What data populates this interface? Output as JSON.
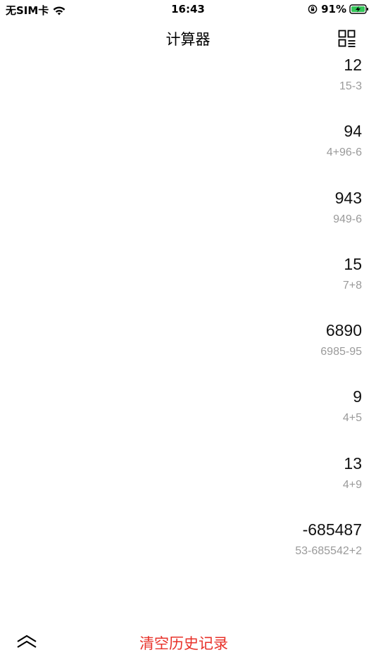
{
  "status_bar": {
    "carrier": "无SIM卡",
    "time": "16:43",
    "battery": "91%"
  },
  "nav": {
    "title": "计算器"
  },
  "history": [
    {
      "result": "12",
      "expression": "15-3"
    },
    {
      "result": "94",
      "expression": "4+96-6"
    },
    {
      "result": "943",
      "expression": "949-6"
    },
    {
      "result": "15",
      "expression": "7+8"
    },
    {
      "result": "6890",
      "expression": "6985-95"
    },
    {
      "result": "9",
      "expression": "4+5"
    },
    {
      "result": "13",
      "expression": "4+9"
    },
    {
      "result": "-685487",
      "expression": "53-685542+2"
    }
  ],
  "bottom": {
    "clear_label": "清空历史记录"
  },
  "colors": {
    "accent": "#e8322a",
    "expression": "#9a9a9a",
    "battery": "#34c759"
  },
  "icons": {
    "wifi": "wifi-icon",
    "orientation_lock": "orientation-lock-icon",
    "battery": "battery-charging-icon",
    "grid": "grid-icon",
    "collapse": "double-chevron-up-icon"
  }
}
